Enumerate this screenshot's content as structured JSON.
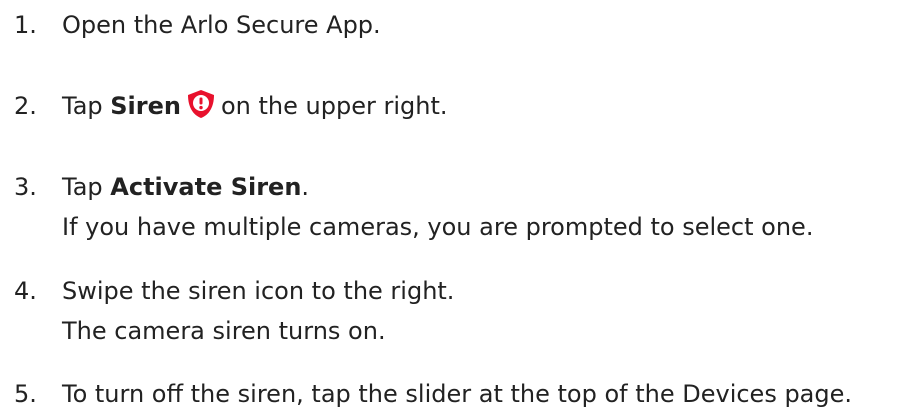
{
  "steps": [
    {
      "num": "1.",
      "text": "Open the Arlo Secure App."
    },
    {
      "num": "2.",
      "pre": "Tap ",
      "bold": "Siren",
      "icon": "siren-icon",
      "post": "on the upper right."
    },
    {
      "num": "3.",
      "pre": "Tap ",
      "bold": "Activate Siren",
      "post": ".",
      "sub": "If you have multiple cameras, you are prompted to select one."
    },
    {
      "num": "4.",
      "text": "Swipe the siren icon to the right.",
      "sub": "The camera siren turns on."
    },
    {
      "num": "5.",
      "text": "To turn off the siren, tap the slider at the top of the Devices page."
    }
  ],
  "colors": {
    "text": "#222222",
    "siren_icon": "#e8112d"
  }
}
